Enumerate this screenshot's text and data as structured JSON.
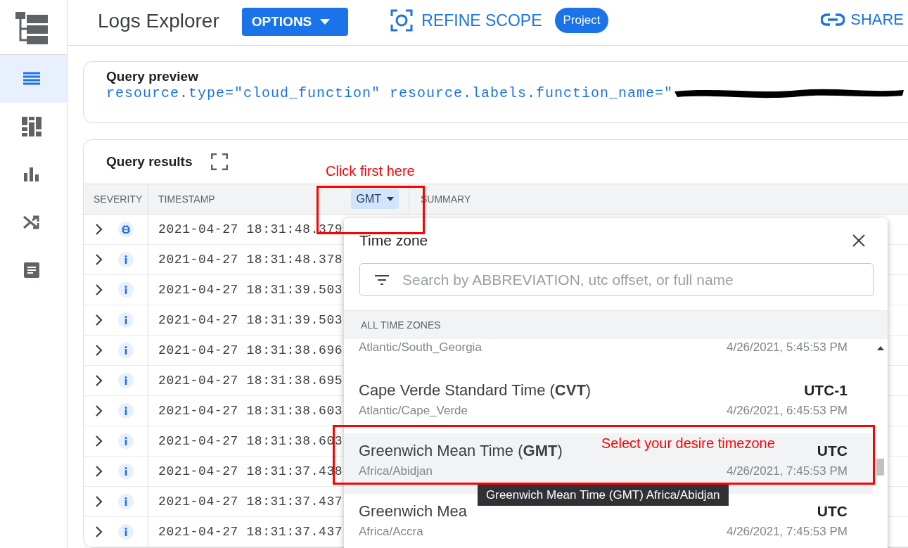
{
  "app_bar": {
    "title": "Logs Explorer",
    "options_button": "OPTIONS",
    "refine_scope_button": "REFINE SCOPE",
    "scope_badge": "Project",
    "share_button": "SHARE"
  },
  "nav_rail": {
    "items": [
      {
        "kind": "list",
        "selected": true
      },
      {
        "kind": "dashboard",
        "selected": false
      },
      {
        "kind": "chart",
        "selected": false
      },
      {
        "kind": "shuffle",
        "selected": false
      },
      {
        "kind": "document",
        "selected": false
      }
    ]
  },
  "query_preview": {
    "title": "Query preview",
    "query": "resource.type=\"cloud_function\" resource.labels.function_name=\"",
    "redacted": true
  },
  "query_results": {
    "title": "Query results",
    "columns": [
      "SEVERITY",
      "TIMESTAMP",
      "SUMMARY"
    ],
    "timezone_button": "GMT",
    "rows": [
      {
        "kind": "debug",
        "timestamp": "2021-04-27 18:31:48.379"
      },
      {
        "kind": "info",
        "timestamp": "2021-04-27 18:31:48.378"
      },
      {
        "kind": "info",
        "timestamp": "2021-04-27 18:31:39.503"
      },
      {
        "kind": "info",
        "timestamp": "2021-04-27 18:31:39.503"
      },
      {
        "kind": "info",
        "timestamp": "2021-04-27 18:31:38.696"
      },
      {
        "kind": "info",
        "timestamp": "2021-04-27 18:31:38.695"
      },
      {
        "kind": "info",
        "timestamp": "2021-04-27 18:31:38.603"
      },
      {
        "kind": "info",
        "timestamp": "2021-04-27 18:31:38.603"
      },
      {
        "kind": "info",
        "timestamp": "2021-04-27 18:31:37.438"
      },
      {
        "kind": "info",
        "timestamp": "2021-04-27 18:31:37.437"
      },
      {
        "kind": "info",
        "timestamp": "2021-04-27 18:31:37.437"
      }
    ]
  },
  "time_zone_dialog": {
    "title": "Time zone",
    "search": {
      "placeholder": "Search by ABBREVIATION, utc offset, or full name"
    },
    "section": "ALL TIME ZONES",
    "zones": [
      {
        "zone": "Atlantic/South_Georgia",
        "datetime": "4/26/2021, 5:45:53 PM",
        "selected": false
      },
      {
        "name": "Cape Verde Standard Time (**CVT**)",
        "offset": "UTC-1",
        "zone": "Atlantic/Cape_Verde",
        "datetime": "4/26/2021, 6:45:53 PM",
        "selected": false
      },
      {
        "name": "Greenwich Mean Time (**GMT**)",
        "offset": "UTC",
        "zone": "Africa/Abidjan",
        "datetime": "4/26/2021, 7:45:53 PM",
        "selected": true
      },
      {
        "name": "Greenwich Mea",
        "offset": "UTC",
        "zone": "Africa/Accra",
        "datetime": "4/26/2021, 7:45:53 PM",
        "selected": false
      }
    ],
    "tooltip": "Greenwich Mean Time (GMT) Africa/Abidjan"
  },
  "annotations": {
    "click_hint": "Click first here",
    "select_hint": "Select your desire timezone"
  }
}
